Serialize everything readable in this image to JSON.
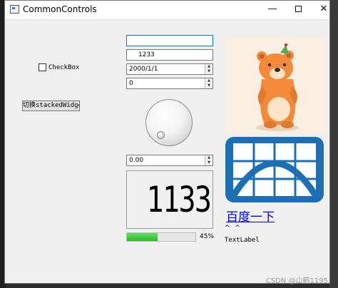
{
  "window": {
    "title": "CommonControls",
    "minimize_glyph": "—",
    "close_glyph": "✕"
  },
  "checkbox": {
    "label": "CheckBox",
    "checked": false
  },
  "switch_button": {
    "label": "切换stackedWidget"
  },
  "line_edit": {
    "value": ""
  },
  "line_edit2": {
    "value": "1233"
  },
  "date_edit": {
    "value": "2000/1/1"
  },
  "spin_box": {
    "value": "0"
  },
  "double_spin_box": {
    "value": "0.00"
  },
  "lcd": {
    "value": "1133"
  },
  "progress": {
    "value": 0.45,
    "label": "45%"
  },
  "link": {
    "label": "百度一下"
  },
  "carets": {
    "text": "^ ^"
  },
  "text_label": {
    "text": "TextLabel"
  },
  "watermark": {
    "text": "CSDN @山鹤1195"
  },
  "colors": {
    "accent": "#0078d7",
    "progress_green": "#3cc43c",
    "link_blue": "#0000ee",
    "map_blue": "#1c6fb5",
    "bear_orange": "#f28a3a"
  },
  "icons": {
    "app": "window-icon",
    "minimize": "minimize-icon",
    "maximize": "maximize-icon",
    "close": "close-icon"
  }
}
